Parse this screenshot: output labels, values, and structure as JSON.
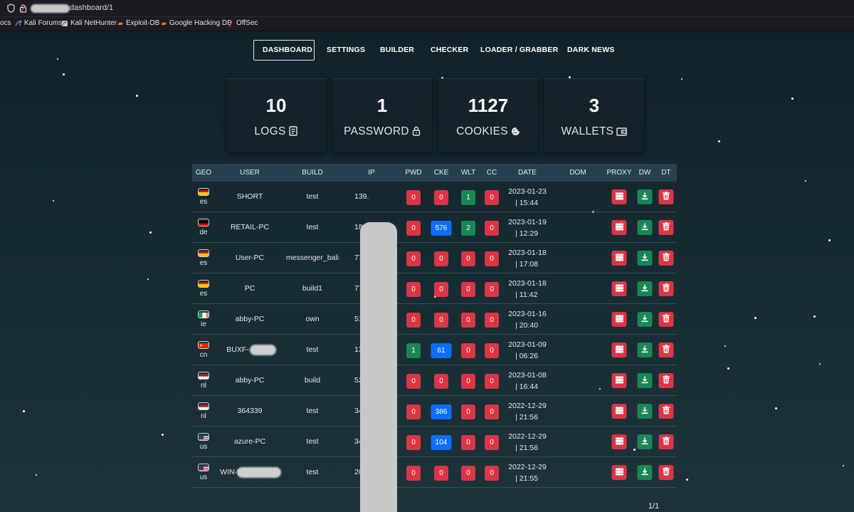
{
  "browser": {
    "url": "dashboard/1",
    "bookmarks": [
      "ocs",
      "Kali Forums",
      "Kali NetHunter",
      "Exploit-DB",
      "Google Hacking DB",
      "OffSec"
    ]
  },
  "nav": [
    "DASHBOARD",
    "SETTINGS",
    "BUILDER",
    "CHECKER",
    "LOADER / GRABBER",
    "DARK NEWS"
  ],
  "stats": [
    {
      "value": "10",
      "label": "LOGS",
      "icon": "log-icon"
    },
    {
      "value": "1",
      "label": "PASSWORD",
      "icon": "lock-icon"
    },
    {
      "value": "1127",
      "label": "COOKIES",
      "icon": "cookie-icon"
    },
    {
      "value": "3",
      "label": "WALLETS",
      "icon": "wallet-icon"
    }
  ],
  "table": {
    "headers": [
      "GEO",
      "USER",
      "BUILD",
      "IP",
      "PWD",
      "CKE",
      "WLT",
      "CC",
      "DATE",
      "DOM",
      "PROXY",
      "DW",
      "DT"
    ],
    "rows": [
      {
        "geo": "es",
        "user": "SHORT",
        "build": "test",
        "ip": "139.",
        "pwd": "0",
        "cke": "0",
        "wlt": "1",
        "cc": "0",
        "date": "2023-01-23",
        "time": "| 15:44"
      },
      {
        "geo": "de",
        "user": "RETAIL-PC",
        "build": "test",
        "ip": "181.",
        "pwd": "0",
        "cke": "576",
        "wlt": "2",
        "cc": "0",
        "date": "2023-01-19",
        "time": "| 12:29"
      },
      {
        "geo": "es",
        "user": "User-PC",
        "build": "messenger_bali",
        "ip": "77.",
        "pwd": "0",
        "cke": "0",
        "wlt": "0",
        "cc": "0",
        "date": "2023-01-18",
        "time": "| 17:08"
      },
      {
        "geo": "es",
        "user": "PC",
        "build": "build1",
        "ip": "77.",
        "pwd": "0",
        "cke": "0",
        "wlt": "0",
        "cc": "0",
        "date": "2023-01-18",
        "time": "| 11:42"
      },
      {
        "geo": "ie",
        "user": "abby-PC",
        "build": "own",
        "ip": "51.1",
        "pwd": "0",
        "cke": "0",
        "wlt": "0",
        "cc": "0",
        "date": "2023-01-16",
        "time": "| 20:40"
      },
      {
        "geo": "cn",
        "user": "BUXF-",
        "build": "test",
        "ip": "139.",
        "pwd": "1",
        "cke": "61",
        "wlt": "0",
        "cc": "0",
        "date": "2023-01-09",
        "time": "| 06:26"
      },
      {
        "geo": "nl",
        "user": "abby-PC",
        "build": "build",
        "ip": "52",
        "pwd": "0",
        "cke": "0",
        "wlt": "0",
        "cc": "0",
        "date": "2023-01-08",
        "time": "| 16:44"
      },
      {
        "geo": "nl",
        "user": "364339",
        "build": "test",
        "ip": "34.",
        "pwd": "0",
        "cke": "386",
        "wlt": "0",
        "cc": "0",
        "date": "2022-12-29",
        "time": "| 21:56"
      },
      {
        "geo": "us",
        "user": "azure-PC",
        "build": "test",
        "ip": "34",
        "pwd": "0",
        "cke": "104",
        "wlt": "0",
        "cc": "0",
        "date": "2022-12-29",
        "time": "| 21:56"
      },
      {
        "geo": "us",
        "user": "WIN-5",
        "build": "test",
        "ip": "20.",
        "pwd": "0",
        "cke": "0",
        "wlt": "0",
        "cc": "0",
        "date": "2022-12-29",
        "time": "| 21:55"
      }
    ]
  },
  "pagination": "1/1",
  "colors": {
    "red": "#dc3545",
    "green": "#198754",
    "blue": "#0d6efd",
    "header": "#27404d",
    "background": "#17262d"
  }
}
